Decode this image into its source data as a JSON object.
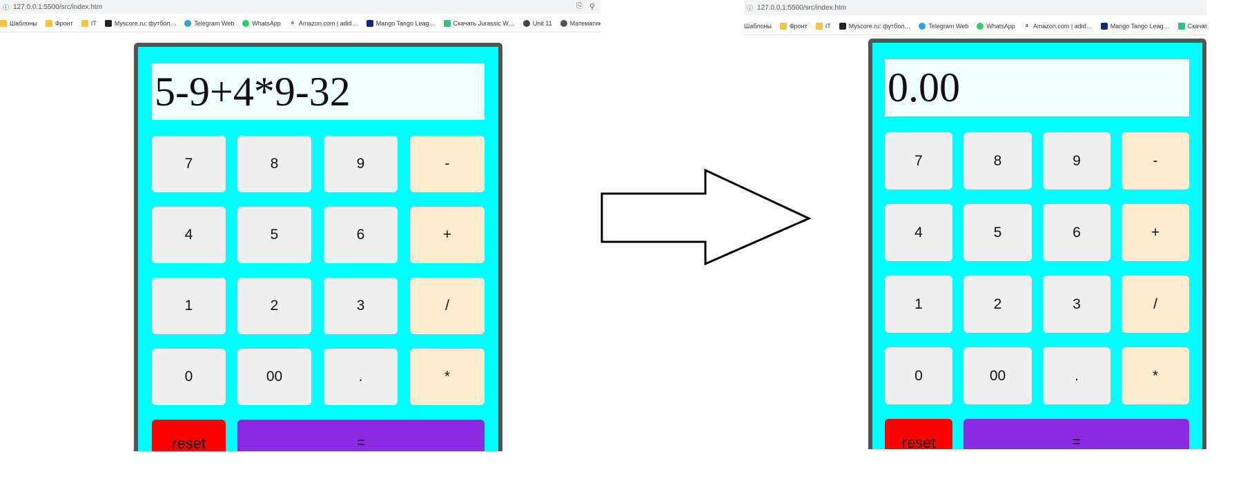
{
  "left": {
    "url": "127.0.0.1:5500/src/index.htm",
    "display": "5-9+4*9-32",
    "bookmarks": [
      "Шаблоны",
      "Фронт",
      "IT",
      "Myscore.ru: футбол…",
      "Telegram Web",
      "WhatsApp",
      "Amazon.com | adid…",
      "Mango Tango Leag…",
      "Скачать Jurassic W…",
      "Unit 11",
      "Математика тест к…"
    ]
  },
  "right": {
    "url": "127.0.0.1:5500/src/index.htm",
    "display": "0.00",
    "bookmarks": [
      "Шаблоны",
      "Фронт",
      "IT",
      "Myscore.ru: футбол…",
      "Telegram Web",
      "WhatsApp",
      "Amazon.com | adid…",
      "Mango Tango Leag…",
      "Скачать Jurassic W…"
    ]
  },
  "keys": {
    "k7": "7",
    "k8": "8",
    "k9": "9",
    "minus": "-",
    "k4": "4",
    "k5": "5",
    "k6": "6",
    "plus": "+",
    "k1": "1",
    "k2": "2",
    "k3": "3",
    "divide": "/",
    "k0": "0",
    "k00": "00",
    "dot": ".",
    "multiply": "*",
    "reset": "reset",
    "equal": "="
  },
  "colors": {
    "calculator_bg": "#00ffff",
    "display_bg": "#f0ffff",
    "digit_key": "#efefef",
    "operator_key": "#ffebcd",
    "reset_key": "#ff0000",
    "equal_key": "#8a2be2",
    "frame": "#545454"
  },
  "icons": [
    "info-icon",
    "translate-icon",
    "zoom-icon",
    "folder-icon",
    "arrow-right-icon"
  ]
}
